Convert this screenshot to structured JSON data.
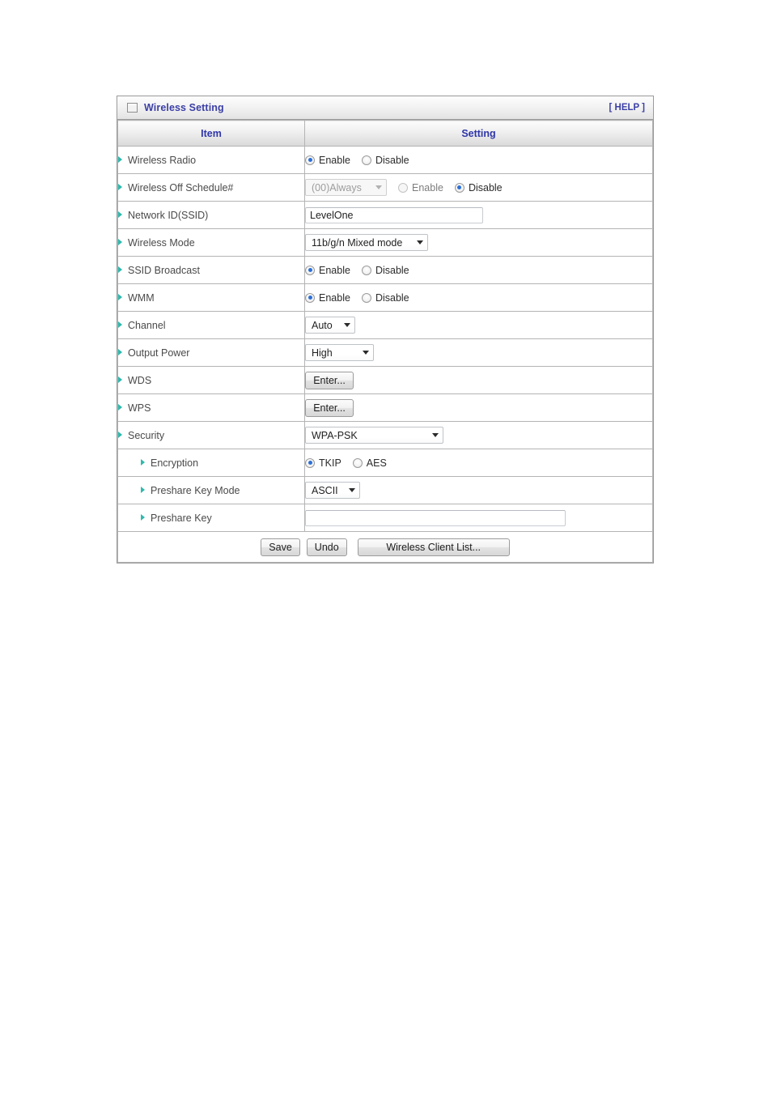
{
  "panel": {
    "title": "Wireless Setting",
    "help_label": "[ HELP ]",
    "window_icon": "window-restore-icon",
    "accent_color": "#3b3fa6",
    "bullet_color": "#2fb9ad",
    "radio_dot_color": "#2a6fd6"
  },
  "table": {
    "headers": {
      "item": "Item",
      "setting": "Setting"
    },
    "rows": [
      {
        "label": "Wireless Radio",
        "indent": false,
        "control": "radio",
        "options": [
          {
            "label": "Enable",
            "selected": true,
            "disabled": false
          },
          {
            "label": "Disable",
            "selected": false,
            "disabled": false
          }
        ]
      },
      {
        "label": "Wireless Off Schedule#",
        "indent": false,
        "control": "select-radio",
        "select_value": "(00)Always",
        "select_disabled": true,
        "options": [
          {
            "label": "Enable",
            "selected": false,
            "disabled": true
          },
          {
            "label": "Disable",
            "selected": true,
            "disabled": false
          }
        ]
      },
      {
        "label": "Network ID(SSID)",
        "indent": false,
        "control": "text",
        "value": "LevelOne",
        "placeholder": ""
      },
      {
        "label": "Wireless Mode",
        "indent": false,
        "control": "select",
        "select_value": "11b/g/n Mixed mode"
      },
      {
        "label": "SSID Broadcast",
        "indent": false,
        "control": "radio",
        "options": [
          {
            "label": "Enable",
            "selected": true,
            "disabled": false
          },
          {
            "label": "Disable",
            "selected": false,
            "disabled": false
          }
        ]
      },
      {
        "label": "WMM",
        "indent": false,
        "control": "radio",
        "options": [
          {
            "label": "Enable",
            "selected": true,
            "disabled": false
          },
          {
            "label": "Disable",
            "selected": false,
            "disabled": false
          }
        ]
      },
      {
        "label": "Channel",
        "indent": false,
        "control": "select",
        "select_value": "Auto"
      },
      {
        "label": "Output Power",
        "indent": false,
        "control": "select",
        "select_value": "High"
      },
      {
        "label": "WDS",
        "indent": false,
        "control": "button",
        "button_label": "Enter..."
      },
      {
        "label": "WPS",
        "indent": false,
        "control": "button",
        "button_label": "Enter..."
      },
      {
        "label": "Security",
        "indent": false,
        "control": "select",
        "select_value": "WPA-PSK"
      },
      {
        "label": "Encryption",
        "indent": true,
        "control": "radio",
        "options": [
          {
            "label": "TKIP",
            "selected": true,
            "disabled": false
          },
          {
            "label": "AES",
            "selected": false,
            "disabled": false
          }
        ]
      },
      {
        "label": "Preshare Key Mode",
        "indent": true,
        "control": "select",
        "select_value": "ASCII"
      },
      {
        "label": "Preshare Key",
        "indent": true,
        "control": "text",
        "value": "",
        "placeholder": ""
      }
    ]
  },
  "actions": {
    "save_label": "Save",
    "undo_label": "Undo",
    "client_list_label": "Wireless Client List..."
  }
}
